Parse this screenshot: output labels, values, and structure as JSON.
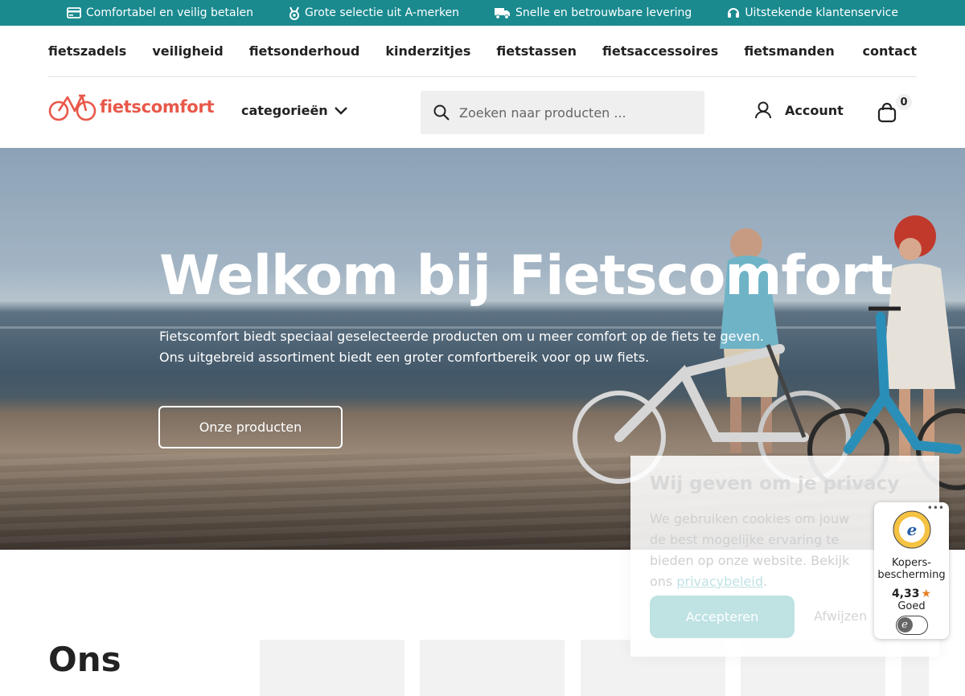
{
  "topbar": {
    "usps": [
      {
        "icon": "credit-card-icon",
        "text": "Comfortabel en veilig betalen"
      },
      {
        "icon": "medal-icon",
        "text": "Grote selectie uit A-merken"
      },
      {
        "icon": "truck-icon",
        "text": "Snelle en betrouwbare levering"
      },
      {
        "icon": "headset-icon",
        "text": "Uitstekende klantenservice"
      }
    ],
    "color": "#1a8a8f"
  },
  "menu": {
    "items": [
      "fietszadels",
      "veiligheid",
      "fietsonderhoud",
      "kinderzitjes",
      "fietstassen",
      "fietsaccessoires",
      "fietsmanden"
    ],
    "contact": "contact"
  },
  "header": {
    "logo_text": "fietscomfort",
    "brand_color": "#e8584a",
    "categories_label": "categorieën",
    "search_placeholder": "Zoeken naar producten ...",
    "account_label": "Account",
    "cart_count": "0"
  },
  "hero": {
    "title": "Welkom bij Fietscomfort",
    "intro_line1": "Fietscomfort biedt speciaal geselecteerde producten om u meer comfort op de fiets te geven.",
    "intro_line2": "Ons uitgebreid assortiment biedt een groter comfortbereik voor op uw fiets.",
    "cta_label": "Onze producten"
  },
  "products_section": {
    "title": "Ons"
  },
  "privacy_popup": {
    "title": "Wij geven om je privacy",
    "text": "We gebruiken cookies om jouw de best mogelijke ervaring te bieden op onze website. Bekijk ons",
    "link_text": "privacybeleid",
    "after_link": ".",
    "accept_label": "Accepteren",
    "reject_label": "Afwijzen"
  },
  "trust_badge": {
    "label_line1": "Kopers-",
    "label_line2": "bescherming",
    "rating": "4,33",
    "grade": "Goed",
    "menu": "•••"
  }
}
